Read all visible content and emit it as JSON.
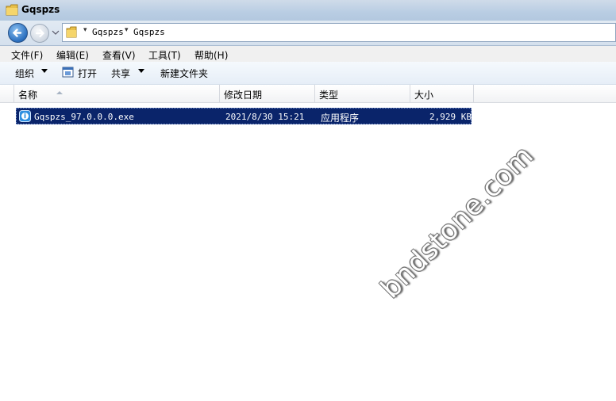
{
  "window": {
    "title": "Gqspzs"
  },
  "address": {
    "crumbs": [
      "Gqspzs",
      "Gqspzs"
    ]
  },
  "menu": [
    "文件(F)",
    "编辑(E)",
    "查看(V)",
    "工具(T)",
    "帮助(H)"
  ],
  "toolbar": {
    "organize": "组织",
    "open": "打开",
    "share": "共享",
    "new_folder": "新建文件夹"
  },
  "columns": {
    "name": "名称",
    "date": "修改日期",
    "type": "类型",
    "size": "大小"
  },
  "files": [
    {
      "name": "Gqspzs_97.0.0.0.exe",
      "date": "2021/8/30 15:21",
      "type": "应用程序",
      "size": "2,929 KB",
      "selected": true
    }
  ],
  "watermark": "bndstone.com",
  "colors": {
    "selection": "#0a246a",
    "title_bar": "#b9cde3"
  }
}
